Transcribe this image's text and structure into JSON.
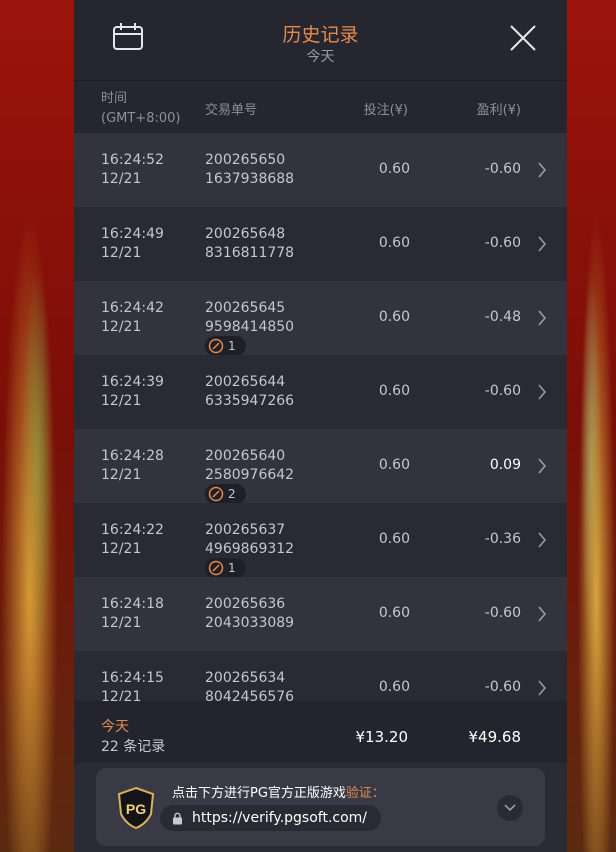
{
  "header": {
    "title": "历史记录",
    "subtitle": "今天"
  },
  "columns": {
    "time_label": "时间",
    "time_zone": "(GMT+8:00)",
    "txn_label": "交易单号",
    "bet_label": "投注(¥)",
    "pl_label": "盈利(¥)"
  },
  "rows": [
    {
      "time": "16:24:52",
      "date": "12/21",
      "id1": "200265650",
      "id2": "1637938688",
      "bet": "0.60",
      "pl": "-0.60",
      "badge": null
    },
    {
      "time": "16:24:49",
      "date": "12/21",
      "id1": "200265648",
      "id2": "8316811778",
      "bet": "0.60",
      "pl": "-0.60",
      "badge": null
    },
    {
      "time": "16:24:42",
      "date": "12/21",
      "id1": "200265645",
      "id2": "9598414850",
      "bet": "0.60",
      "pl": "-0.48",
      "badge": "1"
    },
    {
      "time": "16:24:39",
      "date": "12/21",
      "id1": "200265644",
      "id2": "6335947266",
      "bet": "0.60",
      "pl": "-0.60",
      "badge": null
    },
    {
      "time": "16:24:28",
      "date": "12/21",
      "id1": "200265640",
      "id2": "2580976642",
      "bet": "0.60",
      "pl": "0.09",
      "badge": "2"
    },
    {
      "time": "16:24:22",
      "date": "12/21",
      "id1": "200265637",
      "id2": "4969869312",
      "bet": "0.60",
      "pl": "-0.36",
      "badge": "1"
    },
    {
      "time": "16:24:18",
      "date": "12/21",
      "id1": "200265636",
      "id2": "2043033089",
      "bet": "0.60",
      "pl": "-0.60",
      "badge": null
    },
    {
      "time": "16:24:15",
      "date": "12/21",
      "id1": "200265634",
      "id2": "8042456576",
      "bet": "0.60",
      "pl": "-0.60",
      "badge": null
    }
  ],
  "footer": {
    "period": "今天",
    "count": "22 条记录",
    "total_bet": "¥13.20",
    "total_pl": "¥49.68"
  },
  "verify": {
    "text": "点击下方进行PG官方正版游戏",
    "text_accent": "验证：",
    "url": "https://verify.pgsoft.com/"
  },
  "colors": {
    "accent": "#e58b4d",
    "panel": "#2b2b36",
    "row_alt": "#33333f"
  }
}
